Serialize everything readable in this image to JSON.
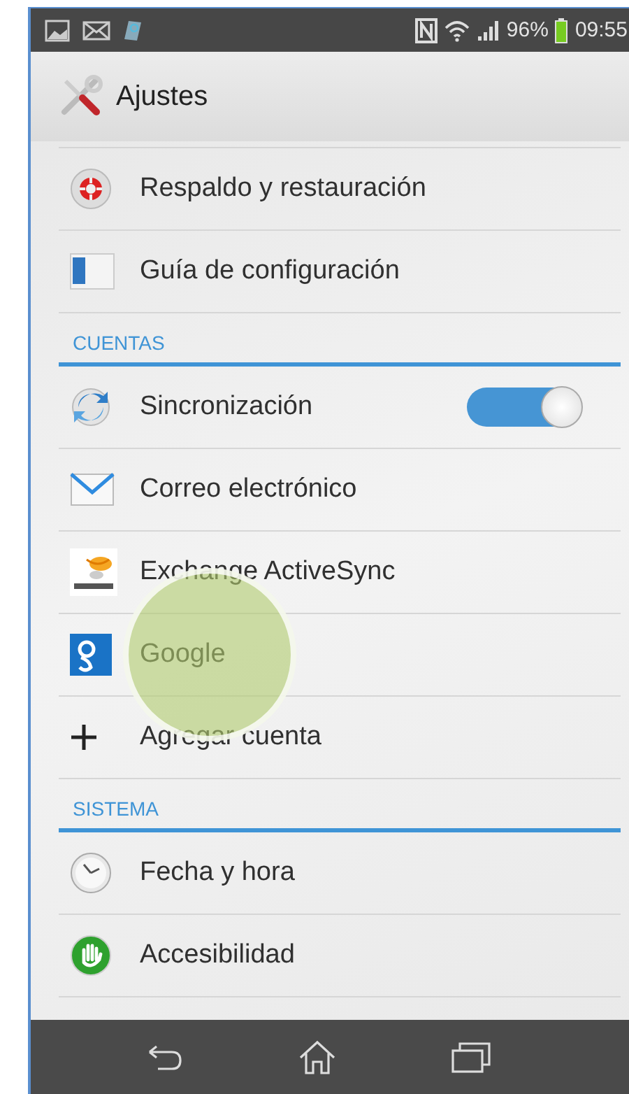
{
  "status_bar": {
    "battery_percent": "96%",
    "time": "09:55"
  },
  "action_bar": {
    "title": "Ajustes"
  },
  "list": [
    {
      "kind": "item",
      "label": "Respaldo y restauración",
      "pressed": false
    },
    {
      "kind": "item",
      "label": "Guía de configuración",
      "pressed": false
    },
    {
      "kind": "header",
      "label": "CUENTAS"
    },
    {
      "kind": "toggle_item",
      "label": "Sincronización",
      "on": true,
      "pressed": false
    },
    {
      "kind": "item",
      "label": "Correo electrónico",
      "pressed": false
    },
    {
      "kind": "item",
      "label": "Exchange ActiveSync",
      "pressed": false
    },
    {
      "kind": "item",
      "label": "Google",
      "pressed": true
    },
    {
      "kind": "add_item",
      "label": "Agregar cuenta",
      "pressed": false
    },
    {
      "kind": "header",
      "label": "SISTEMA"
    },
    {
      "kind": "item",
      "label": "Fecha y hora",
      "pressed": false
    },
    {
      "kind": "item",
      "label": "Accesibilidad",
      "pressed": false
    }
  ]
}
